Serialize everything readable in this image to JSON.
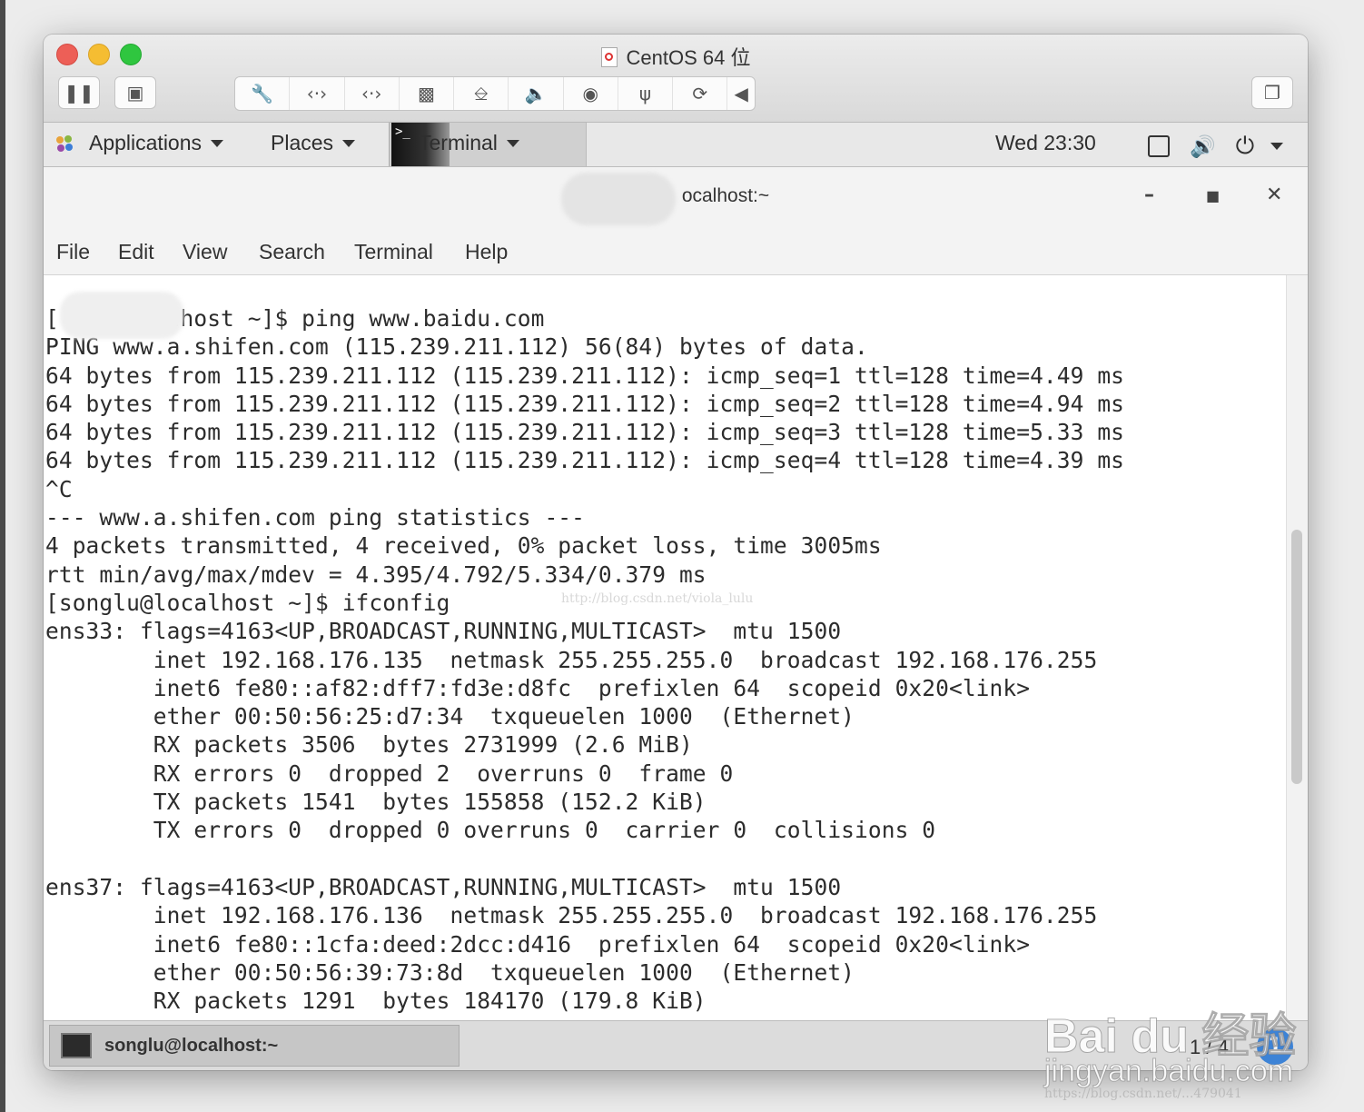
{
  "vm": {
    "title": "CentOS 64 位",
    "toolbar_icons": [
      "pause-icon",
      "snapshot-icon",
      "wrench-icon",
      "network-icon",
      "network-icon",
      "disk-icon",
      "printer-icon",
      "sound-icon",
      "camera-icon",
      "usb-icon",
      "refresh-icon",
      "arrow-left-icon",
      "window-icon"
    ]
  },
  "gnome": {
    "applications": "Applications",
    "places": "Places",
    "terminal": "Terminal",
    "clock": "Wed 23:30"
  },
  "terminal": {
    "title": "ocalhost:~",
    "menu": [
      "File",
      "Edit",
      "View",
      "Search",
      "Terminal",
      "Help"
    ],
    "lines": [
      "[     ocalhost ~]$ ping www.baidu.com",
      "PING www.a.shifen.com (115.239.211.112) 56(84) bytes of data.",
      "64 bytes from 115.239.211.112 (115.239.211.112): icmp_seq=1 ttl=128 time=4.49 ms",
      "64 bytes from 115.239.211.112 (115.239.211.112): icmp_seq=2 ttl=128 time=4.94 ms",
      "64 bytes from 115.239.211.112 (115.239.211.112): icmp_seq=3 ttl=128 time=5.33 ms",
      "64 bytes from 115.239.211.112 (115.239.211.112): icmp_seq=4 ttl=128 time=4.39 ms",
      "^C",
      "--- www.a.shifen.com ping statistics ---",
      "4 packets transmitted, 4 received, 0% packet loss, time 3005ms",
      "rtt min/avg/max/mdev = 4.395/4.792/5.334/0.379 ms",
      "[songlu@localhost ~]$ ifconfig",
      "ens33: flags=4163<UP,BROADCAST,RUNNING,MULTICAST>  mtu 1500",
      "        inet 192.168.176.135  netmask 255.255.255.0  broadcast 192.168.176.255",
      "        inet6 fe80::af82:dff7:fd3e:d8fc  prefixlen 64  scopeid 0x20<link>",
      "        ether 00:50:56:25:d7:34  txqueuelen 1000  (Ethernet)",
      "        RX packets 3506  bytes 2731999 (2.6 MiB)",
      "        RX errors 0  dropped 2  overruns 0  frame 0",
      "        TX packets 1541  bytes 155858 (152.2 KiB)",
      "        TX errors 0  dropped 0 overruns 0  carrier 0  collisions 0",
      "",
      "ens37: flags=4163<UP,BROADCAST,RUNNING,MULTICAST>  mtu 1500",
      "        inet 192.168.176.136  netmask 255.255.255.0  broadcast 192.168.176.255",
      "        inet6 fe80::1cfa:deed:2dcc:d416  prefixlen 64  scopeid 0x20<link>",
      "        ether 00:50:56:39:73:8d  txqueuelen 1000  (Ethernet)",
      "        RX packets 1291  bytes 184170 (179.8 KiB)"
    ],
    "watermark": "http://blog.csdn.net/viola_lulu"
  },
  "taskbar": {
    "item": "songlu@localhost:~",
    "pager": "1 / 4",
    "badge": "1"
  },
  "watermark": {
    "logo": "Bai du 经验",
    "site": "jingyan.baidu.com",
    "csdn": "https://blog.csdn.net/...479041"
  }
}
